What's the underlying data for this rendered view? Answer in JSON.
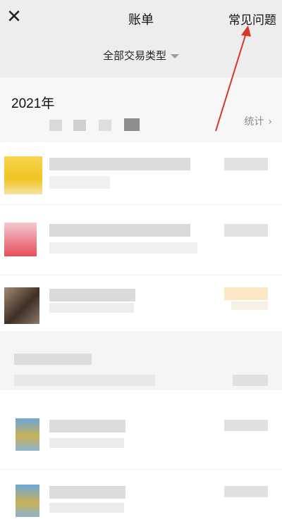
{
  "header": {
    "title": "账单",
    "faq_label": "常见问题",
    "close_icon": "close-icon"
  },
  "filter": {
    "label": "全部交易类型"
  },
  "month": {
    "title": "2021年",
    "stats_label": "统计",
    "stats_chevron": "›"
  },
  "colors": {
    "annotation_arrow": "#d9362b",
    "background": "#ededed"
  }
}
